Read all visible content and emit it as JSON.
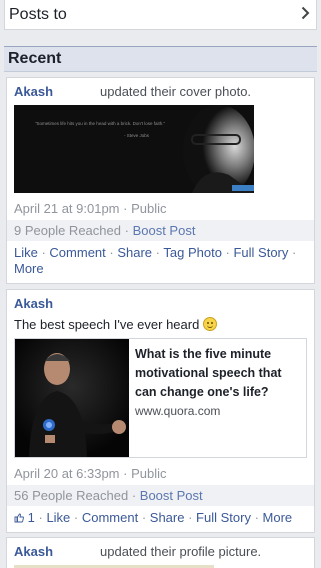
{
  "posts_to": {
    "label": "Posts to"
  },
  "section": {
    "title": "Recent"
  },
  "posts": [
    {
      "author": "Akash",
      "action": "updated their cover photo.",
      "cover_caption_1": "\"Sometimes life hits you in the head with a brick. Don't lose faith.\"",
      "cover_caption_2": "- Steve Jobs",
      "date": "April 21 at 9:01pm",
      "privacy": "Public",
      "reach": "9 People Reached",
      "boost": "Boost Post",
      "actions": [
        "Like",
        "Comment",
        "Share",
        "Tag Photo",
        "Full Story",
        "More"
      ]
    },
    {
      "author": "Akash",
      "status": "The best speech I've ever heard",
      "link_title": "What is the five minute motivational speech that can change one's life?",
      "link_host": "www.quora.com",
      "date": "April 20 at 6:33pm",
      "privacy": "Public",
      "reach": "56 People Reached",
      "boost": "Boost Post",
      "likes": "1",
      "actions": [
        "Like",
        "Comment",
        "Share",
        "Full Story",
        "More"
      ]
    },
    {
      "author": "Akash",
      "action": "updated their profile picture."
    }
  ],
  "colors": {
    "link": "#3b5998",
    "meta": "#90949c",
    "header_bg": "#dde2ec"
  }
}
